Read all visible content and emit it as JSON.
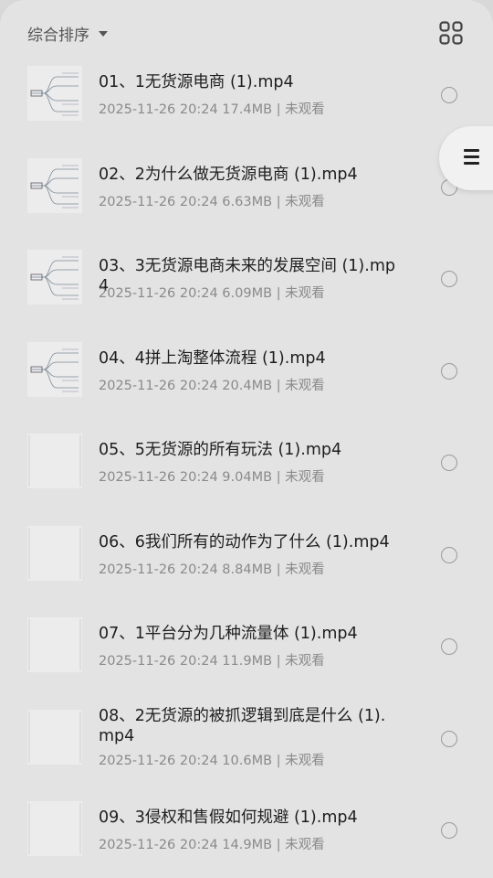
{
  "toolbar": {
    "sort_label": "综合排序",
    "sort_icon": "caret-down-icon",
    "layout_icon": "grid-view-icon",
    "menu_icon": "list-menu-icon"
  },
  "files": [
    {
      "title": "01、1无货源电商 (1).mp4",
      "date": "2025-11-26 20:24",
      "size": "17.4MB",
      "status": "未观看",
      "thumb": "mindmap"
    },
    {
      "title": "02、2为什么做无货源电商 (1).mp4",
      "date": "2025-11-26 20:24",
      "size": "6.63MB",
      "status": "未观看",
      "thumb": "mindmap"
    },
    {
      "title": "03、3无货源电商未来的发展空间 (1).mp4",
      "date": "2025-11-26 20:24",
      "size": "6.09MB",
      "status": "未观看",
      "thumb": "mindmap"
    },
    {
      "title": "04、4拼上淘整体流程 (1).mp4",
      "date": "2025-11-26 20:24",
      "size": "20.4MB",
      "status": "未观看",
      "thumb": "mindmap"
    },
    {
      "title": "05、5无货源的所有玩法 (1).mp4",
      "date": "2025-11-26 20:24",
      "size": "9.04MB",
      "status": "未观看",
      "thumb": "blank"
    },
    {
      "title": "06、6我们所有的动作为了什么 (1).mp4",
      "date": "2025-11-26 20:24",
      "size": "8.84MB",
      "status": "未观看",
      "thumb": "blank"
    },
    {
      "title": "07、1平台分为几种流量体 (1).mp4",
      "date": "2025-11-26 20:24",
      "size": "11.9MB",
      "status": "未观看",
      "thumb": "blank"
    },
    {
      "title": "08、2无货源的被抓逻辑到底是什么 (1).mp4",
      "date": "2025-11-26 20:24",
      "size": "10.6MB",
      "status": "未观看",
      "thumb": "blank"
    },
    {
      "title": "09、3侵权和售假如何规避 (1).mp4",
      "date": "2025-11-26 20:24",
      "size": "14.9MB",
      "status": "未观看",
      "thumb": "blank"
    }
  ]
}
